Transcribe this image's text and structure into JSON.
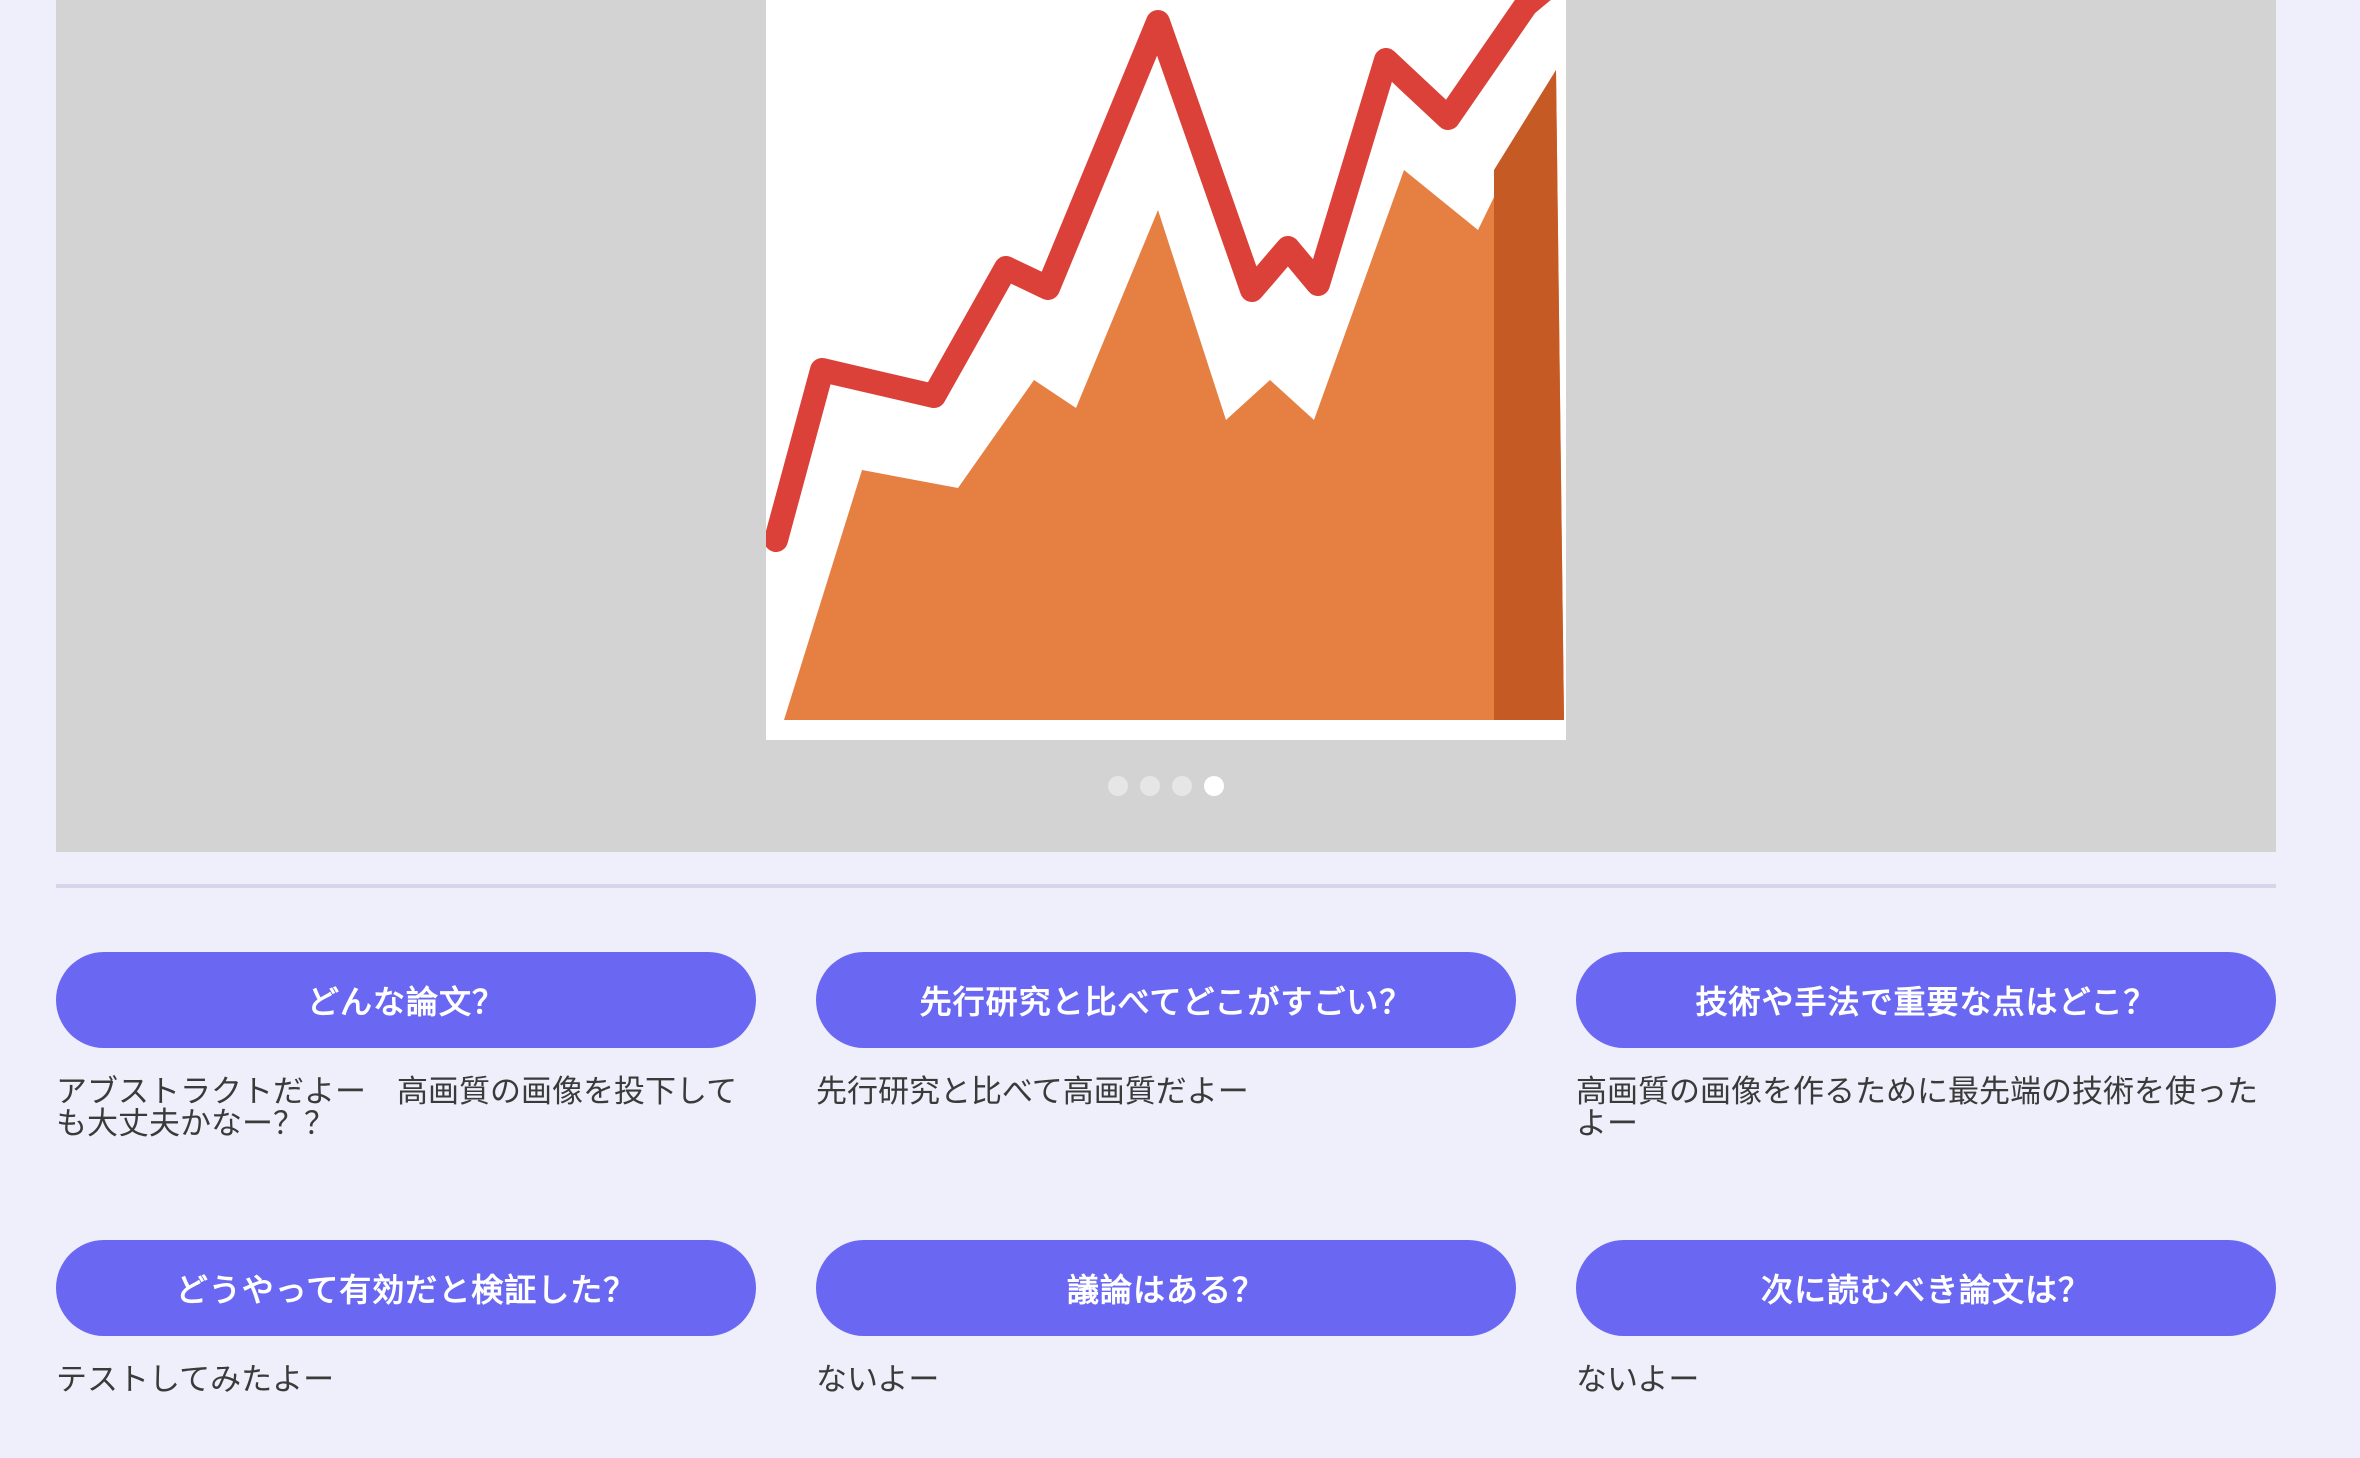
{
  "carousel": {
    "image_icon": "area-line-chart-icon",
    "dot_count": 4,
    "active_index": 3,
    "colors": {
      "background": "#d3d3d3",
      "line": "#db4139",
      "area": "#e67f42",
      "area_dark": "#c65a24"
    }
  },
  "qa": [
    {
      "question": "どんな論文？",
      "answer": "アブストラクトだよー　高画質の画像を投下しても大丈夫かなー？？"
    },
    {
      "question": "先行研究と比べてどこがすごい？",
      "answer": "先行研究と比べて高画質だよー"
    },
    {
      "question": "技術や手法で重要な点はどこ？",
      "answer": "高画質の画像を作るために最先端の技術を使ったよー"
    },
    {
      "question": "どうやって有効だと検証した？",
      "answer": "テストしてみたよー"
    },
    {
      "question": "議論はある？",
      "answer": "ないよー"
    },
    {
      "question": "次に読むべき論文は？",
      "answer": "ないよー"
    }
  ],
  "colors": {
    "page_background": "#efeffb",
    "button": "#6a68f3",
    "button_text": "#ffffff"
  }
}
